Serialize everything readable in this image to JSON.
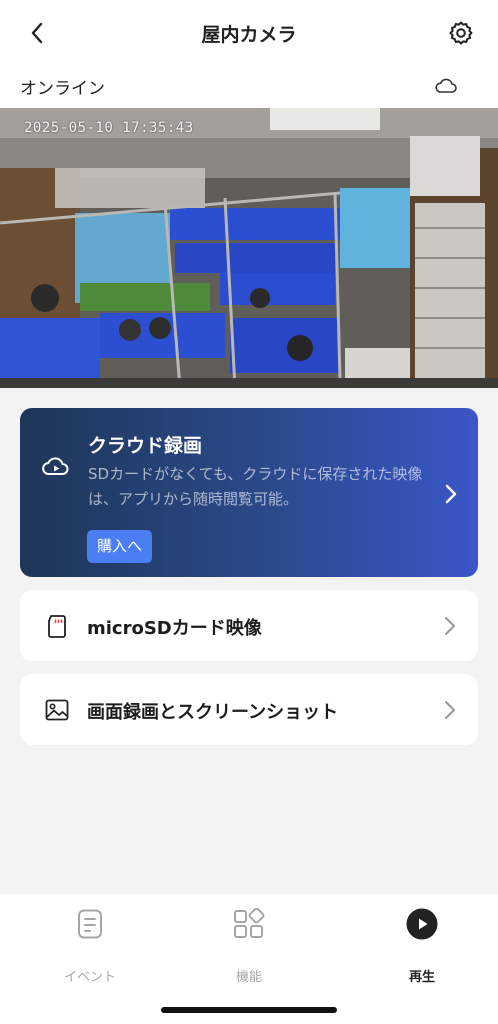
{
  "header": {
    "title": "屋内カメラ",
    "back_icon": "chevron-left-icon",
    "settings_icon": "gear-icon"
  },
  "status": {
    "connection": "オンライン",
    "cloud_icon": "cloud-icon"
  },
  "camera": {
    "timestamp": "2025-05-10  17:35:43"
  },
  "cloud_card": {
    "title": "クラウド録画",
    "description": "SDカードがなくても、クラウドに保存された映像は、アプリから随時閲覧可能。",
    "buy_label": "購入へ",
    "icon": "cloud-play-icon",
    "gradient_start": "#1e3657",
    "gradient_end": "#3a56c9",
    "button_color": "#4a7ef2"
  },
  "list": [
    {
      "label": "microSDカード映像",
      "icon": "sd-card-icon"
    },
    {
      "label": "画面録画とスクリーンショット",
      "icon": "image-icon"
    }
  ],
  "tabs": [
    {
      "label": "イベント",
      "icon": "document-icon",
      "active": false
    },
    {
      "label": "機能",
      "icon": "grid-icon",
      "active": false
    },
    {
      "label": "再生",
      "icon": "play-circle-icon",
      "active": true
    }
  ],
  "colors": {
    "background": "#f3f3f3",
    "active_tab": "#222222",
    "inactive_tab": "#a6a6a6"
  }
}
